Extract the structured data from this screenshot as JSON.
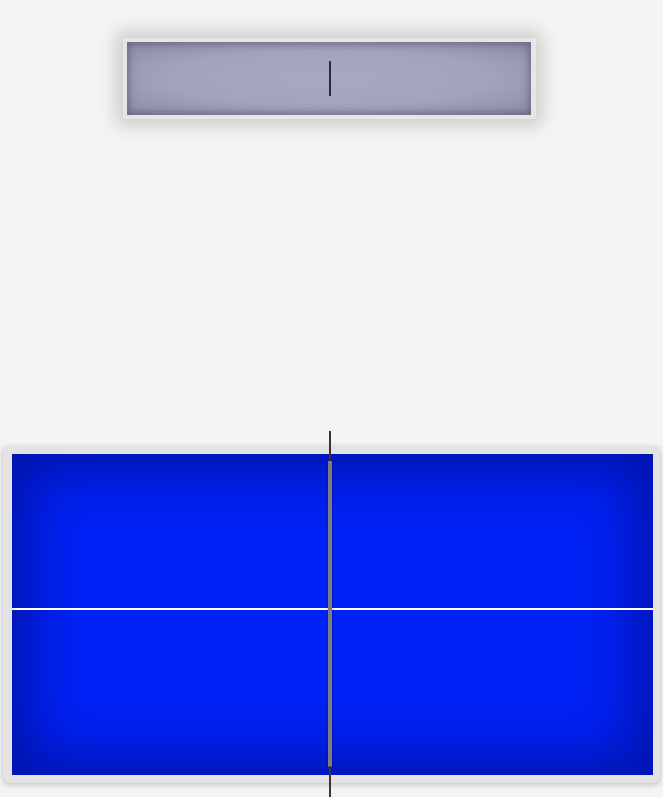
{
  "scoreboard": {
    "player_left_score": "",
    "player_right_score": ""
  },
  "colors": {
    "background": "#f4f4f4",
    "scoreboard_panel": "#a9a8c2",
    "table_surface": "#0022f6",
    "table_border": "#e3e3e3",
    "center_line": "#ffffff",
    "net": "#7d7d7d",
    "net_post": "#3a3433"
  }
}
